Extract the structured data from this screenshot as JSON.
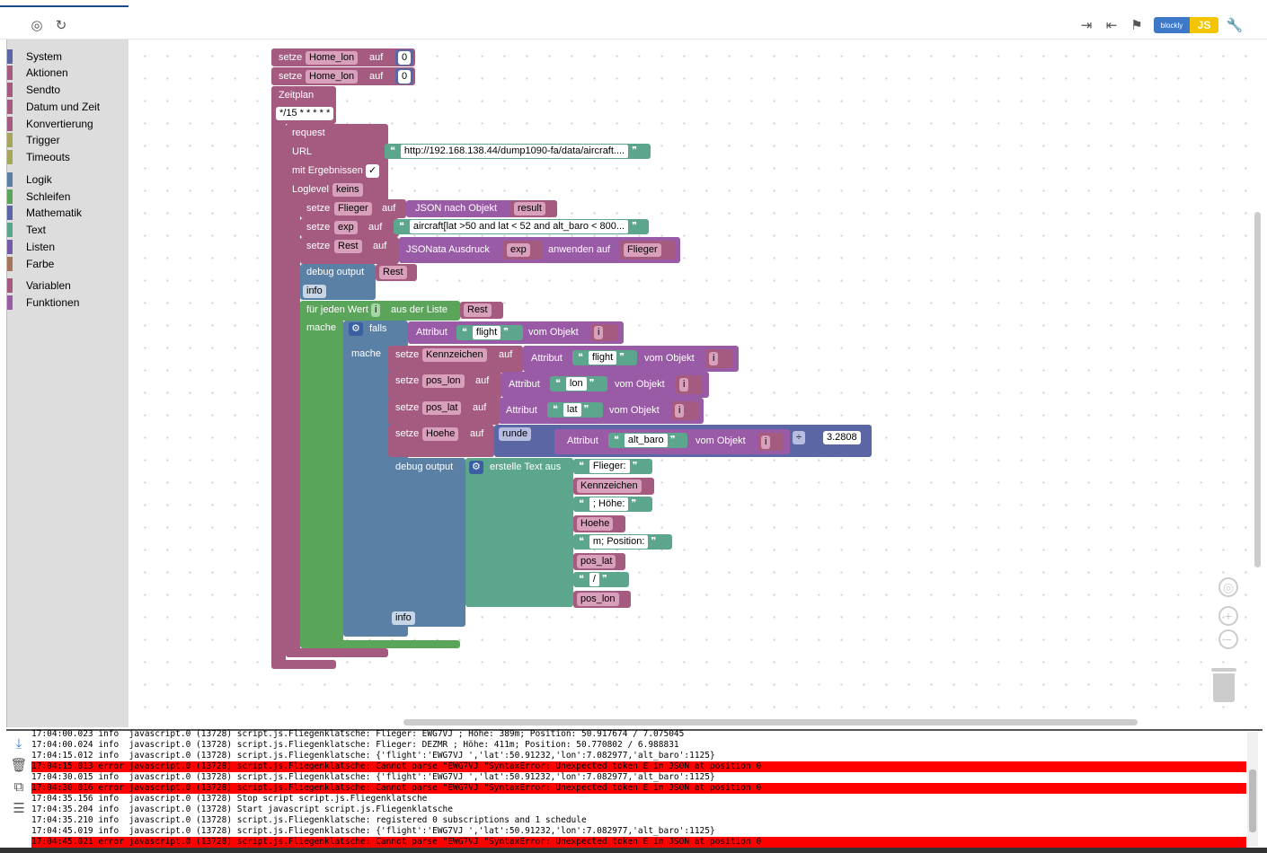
{
  "toolbar": {
    "icons": [
      "target-icon",
      "refresh-icon",
      "export-icon",
      "import-icon",
      "flag-icon",
      "wrench-icon"
    ],
    "badge_blockly": "blockly",
    "badge_js": "JS"
  },
  "sidebar": {
    "items": [
      {
        "label": "System",
        "color": "#5b67a5"
      },
      {
        "label": "Aktionen",
        "color": "#a55b80"
      },
      {
        "label": "Sendto",
        "color": "#a55b80"
      },
      {
        "label": "Datum und Zeit",
        "color": "#a55b80"
      },
      {
        "label": "Konvertierung",
        "color": "#a55b80"
      },
      {
        "label": "Trigger",
        "color": "#a5a55b"
      },
      {
        "label": "Timeouts",
        "color": "#a5a55b"
      },
      {
        "label": "Logik",
        "color": "#5b80a5"
      },
      {
        "label": "Schleifen",
        "color": "#5ba55b"
      },
      {
        "label": "Mathematik",
        "color": "#5b67a5"
      },
      {
        "label": "Text",
        "color": "#5ba58c"
      },
      {
        "label": "Listen",
        "color": "#745ba5"
      },
      {
        "label": "Farbe",
        "color": "#a5745b"
      },
      {
        "label": "Variablen",
        "color": "#a55b80"
      },
      {
        "label": "Funktionen",
        "color": "#995ba5"
      }
    ]
  },
  "blocks": {
    "setze": "setze",
    "auf": "auf",
    "home_lon": "Home_lon",
    "zero": "0",
    "zeitplan": "Zeitplan",
    "cron": "*/15 * * * * *",
    "request": "request",
    "url": "URL",
    "url_value": "http://192.168.138.44/dump1090-fa/data/aircraft....",
    "mit_ergebnissen": "mit Ergebnissen",
    "check": "✓",
    "loglevel": "Loglevel",
    "keins": "keins",
    "flieger": "Flieger",
    "json_nach_objekt": "JSON nach Objekt",
    "result": "result",
    "exp": "exp",
    "exp_value": "aircraft[lat >50 and lat < 52 and alt_baro < 800...",
    "rest": "Rest",
    "jsonata": "JSONata Ausdruck",
    "anwenden_auf": "anwenden auf",
    "debug_output": "debug output",
    "info": "info",
    "fuer_jeden_wert": "für jeden Wert",
    "i": "i",
    "aus_der_liste": "aus der Liste",
    "mache": "mache",
    "falls": "falls",
    "attribut": "Attribut",
    "flight": "flight",
    "vom_objekt": "vom Objekt",
    "kennzeichen": "Kennzeichen",
    "pos_lon": "pos_lon",
    "lon": "lon",
    "pos_lat": "pos_lat",
    "lat": "lat",
    "hoehe": "Hoehe",
    "runde": "runde",
    "alt_baro": "alt_baro",
    "div": "÷",
    "factor": "3.2808",
    "erstelle_text_aus": "erstelle Text aus",
    "t_flieger": "Flieger:",
    "t_hoehe": "; Höhe:",
    "t_position": "m; Position:",
    "t_slash": "/"
  },
  "log": {
    "rows": [
      {
        "text": "17:04:00.023 info  javascript.0 (13728) script.js.Fliegenklatsche: Flieger: EWG7VJ ; Höhe: 389m; Position: 50.917674 / 7.075045",
        "level": "info"
      },
      {
        "text": "17:04:00.024 info  javascript.0 (13728) script.js.Fliegenklatsche: Flieger: DEZMR ; Höhe: 411m; Position: 50.770802 / 6.988831",
        "level": "info"
      },
      {
        "text": "17:04:15.012 info  javascript.0 (13728) script.js.Fliegenklatsche: {'flight':'EWG7VJ ','lat':50.91232,'lon':7.082977,'alt_baro':1125}",
        "level": "info"
      },
      {
        "text": "17:04:15.013 error javascript.0 (13728) script.js.Fliegenklatsche: Cannot parse \"EWG7VJ \"SyntaxError: Unexpected token E in JSON at position 0",
        "level": "error"
      },
      {
        "text": "17:04:30.015 info  javascript.0 (13728) script.js.Fliegenklatsche: {'flight':'EWG7VJ ','lat':50.91232,'lon':7.082977,'alt_baro':1125}",
        "level": "info"
      },
      {
        "text": "17:04:30.016 error javascript.0 (13728) script.js.Fliegenklatsche: Cannot parse \"EWG7VJ \"SyntaxError: Unexpected token E in JSON at position 0",
        "level": "error"
      },
      {
        "text": "17:04:35.156 info  javascript.0 (13728) Stop script script.js.Fliegenklatsche",
        "level": "info"
      },
      {
        "text": "17:04:35.204 info  javascript.0 (13728) Start javascript script.js.Fliegenklatsche",
        "level": "info"
      },
      {
        "text": "17:04:35.210 info  javascript.0 (13728) script.js.Fliegenklatsche: registered 0 subscriptions and 1 schedule",
        "level": "info"
      },
      {
        "text": "17:04:45.019 info  javascript.0 (13728) script.js.Fliegenklatsche: {'flight':'EWG7VJ ','lat':50.91232,'lon':7.082977,'alt_baro':1125}",
        "level": "info"
      },
      {
        "text": "17:04:45.021 error javascript.0 (13728) script.js.Fliegenklatsche: Cannot parse \"EWG7VJ \"SyntaxError: Unexpected token E in JSON at position 0",
        "level": "error"
      }
    ]
  }
}
